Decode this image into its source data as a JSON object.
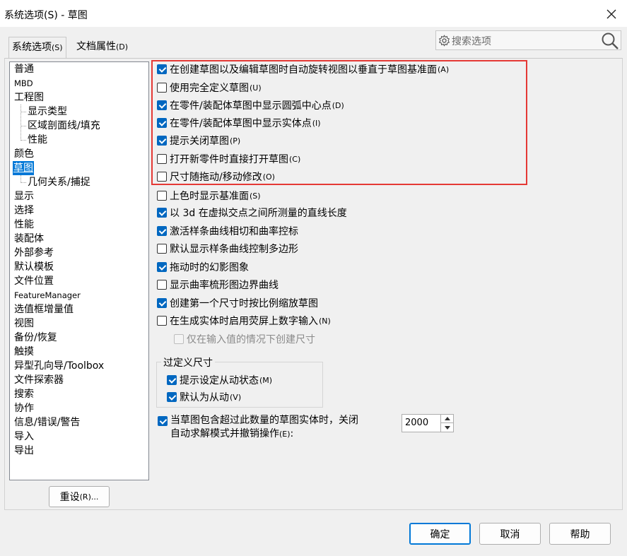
{
  "window": {
    "title": "系统选项(S) - 草图"
  },
  "tabs": [
    {
      "label": "系统选项",
      "hotkey": "(S)",
      "active": true
    },
    {
      "label": "文档属性",
      "hotkey": "(D)",
      "active": false
    }
  ],
  "search": {
    "placeholder": "搜索选项"
  },
  "tree": {
    "items": [
      {
        "label": "普通"
      },
      {
        "label": "MBD"
      },
      {
        "label": "工程图"
      },
      {
        "label": "显示类型"
      },
      {
        "label": "区域剖面线/填充"
      },
      {
        "label": "性能"
      },
      {
        "label": "颜色"
      },
      {
        "label": "草图",
        "selected": true
      },
      {
        "label": "几何关系/捕捉"
      },
      {
        "label": "显示"
      },
      {
        "label": "选择"
      },
      {
        "label": "性能"
      },
      {
        "label": "装配体"
      },
      {
        "label": "外部参考"
      },
      {
        "label": "默认模板"
      },
      {
        "label": "文件位置"
      },
      {
        "label": "FeatureManager"
      },
      {
        "label": "选值框增量值"
      },
      {
        "label": "视图"
      },
      {
        "label": "备份/恢复"
      },
      {
        "label": "触摸"
      },
      {
        "label": "异型孔向导/Toolbox"
      },
      {
        "label": "文件探索器"
      },
      {
        "label": "搜索"
      },
      {
        "label": "协作"
      },
      {
        "label": "信息/错误/警告"
      },
      {
        "label": "导入"
      },
      {
        "label": "导出"
      }
    ]
  },
  "reset_button": {
    "label": "重设",
    "hotkey": "(R)..."
  },
  "options": [
    {
      "label": "在创建草图以及编辑草图时自动旋转视图以垂直于草图基准面",
      "hotkey": "(A)",
      "checked": true
    },
    {
      "label": "使用完全定义草图",
      "hotkey": "(U)",
      "checked": false
    },
    {
      "label": "在零件/装配体草图中显示圆弧中心点",
      "hotkey": "(D)",
      "checked": true
    },
    {
      "label": "在零件/装配体草图中显示实体点",
      "hotkey": "(I)",
      "checked": true
    },
    {
      "label": "提示关闭草图",
      "hotkey": "(P)",
      "checked": true
    },
    {
      "label": "打开新零件时直接打开草图",
      "hotkey": "(C)",
      "checked": false
    },
    {
      "label": "尺寸随拖动/移动修改",
      "hotkey": "(O)",
      "checked": false
    },
    {
      "label": "上色时显示基准面",
      "hotkey": "(S)",
      "checked": false
    },
    {
      "label": "以 3d 在虚拟交点之间所测量的直线长度",
      "hotkey": "",
      "checked": true
    },
    {
      "label": "激活样条曲线相切和曲率控标",
      "hotkey": "",
      "checked": true
    },
    {
      "label": "默认显示样条曲线控制多边形",
      "hotkey": "",
      "checked": false
    },
    {
      "label": "拖动时的幻影图象",
      "hotkey": "",
      "checked": true
    },
    {
      "label": "显示曲率梳形图边界曲线",
      "hotkey": "",
      "checked": false
    },
    {
      "label": "创建第一个尺寸时按比例缩放草图",
      "hotkey": "",
      "checked": true
    },
    {
      "label": "在生成实体时启用荧屏上数字输入",
      "hotkey": "(N)",
      "checked": false
    },
    {
      "label": "仅在输入值的情况下创建尺寸",
      "hotkey": "",
      "checked": false,
      "disabled": true
    }
  ],
  "overdefined": {
    "title": "过定义尺寸",
    "options": [
      {
        "label": "提示设定从动状态",
        "hotkey": "(M)",
        "checked": true
      },
      {
        "label": "默认为从动",
        "hotkey": "(V)",
        "checked": true
      }
    ]
  },
  "limit_option": {
    "line1": "当草图包含超过此数量的草图实体时，关闭",
    "line2": "自动求解模式并撤销操作",
    "hotkey": "(E)",
    "suffix": ":",
    "checked": true,
    "value": "2000"
  },
  "footer": {
    "ok": "确定",
    "cancel": "取消",
    "help": "帮助"
  },
  "colors": {
    "accent": "#0078d7",
    "highlight_box": "#e53935"
  }
}
